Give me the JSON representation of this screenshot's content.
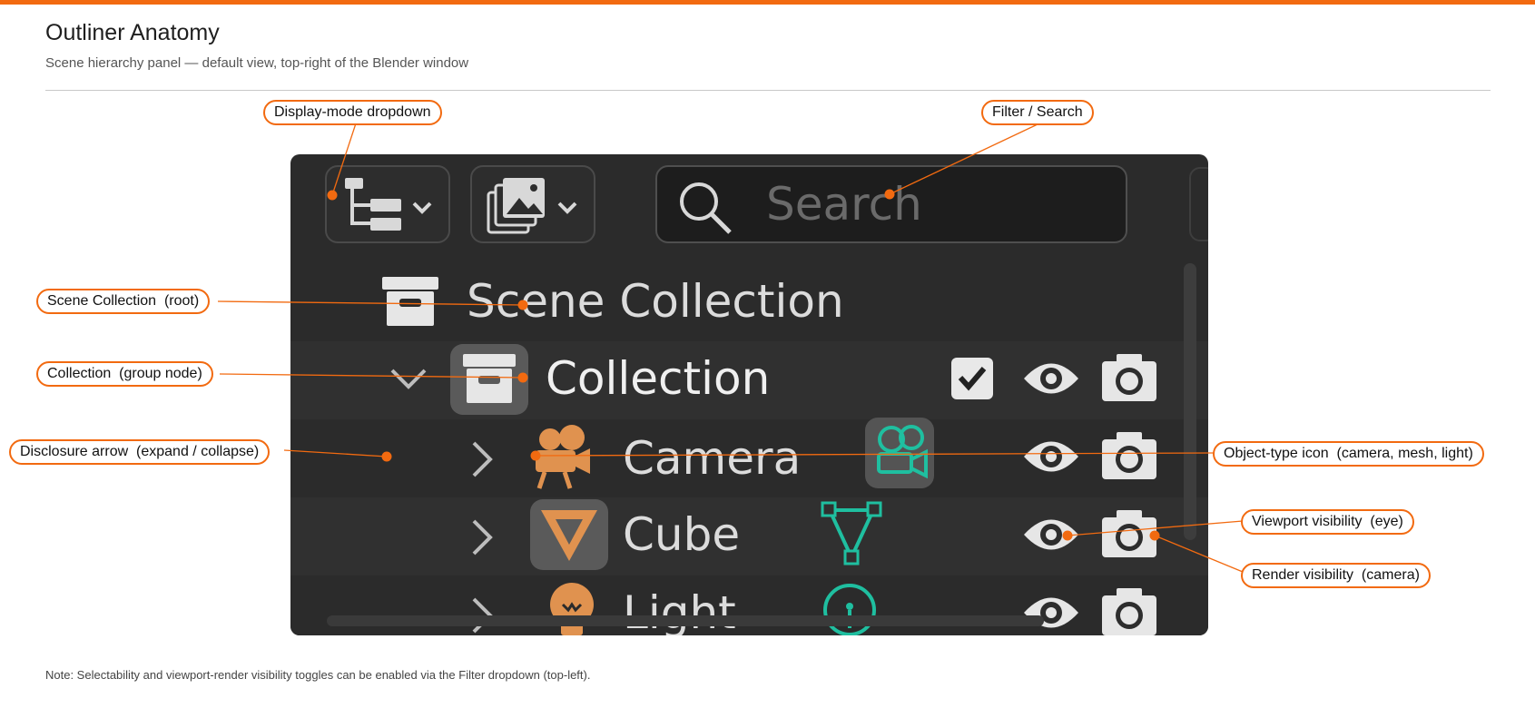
{
  "header": {
    "title": "Outliner Anatomy",
    "subtitle": "Scene hierarchy panel — default view, top-right of the Blender window"
  },
  "outliner": {
    "search_placeholder": "Search",
    "rows": [
      {
        "label": "Scene Collection",
        "icon": "scene-collection-icon"
      },
      {
        "label": "Collection",
        "icon": "collection-icon",
        "expanded": true,
        "checked": true
      },
      {
        "label": "Camera",
        "icon": "camera-object-icon",
        "data_icon": "camera-data-icon"
      },
      {
        "label": "Cube",
        "icon": "mesh-object-icon",
        "data_icon": "mesh-data-icon"
      },
      {
        "label": "Light",
        "icon": "light-object-icon",
        "data_icon": "light-data-icon"
      }
    ],
    "colors": {
      "panel_bg": "#2b2b2b",
      "object_orange": "#e0924f",
      "data_teal": "#1fbfa0",
      "text": "#dcdcdc"
    }
  },
  "callouts": {
    "display_mode": "Display-mode dropdown",
    "filter_search": "Filter / Search",
    "scene_collection": "Scene Collection  (root)",
    "collection": "Collection  (group node)",
    "disclosure_arrow": "Disclosure arrow  (expand / collapse)",
    "object_type_icon": "Object-type icon  (camera, mesh, light)",
    "viewport_visibility": "Viewport visibility  (eye)",
    "render_visibility": "Render visibility  (camera)",
    "accent_color": "#f26a10"
  },
  "footer": {
    "note": "Note: Selectability and viewport-render visibility toggles can be enabled via the Filter dropdown (top-left)."
  }
}
